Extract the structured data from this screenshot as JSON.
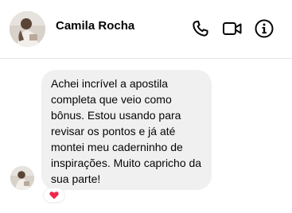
{
  "contact": {
    "name": "Camila Rocha",
    "avatar_icon": "profile-photo-icon"
  },
  "header_actions": [
    {
      "name": "call",
      "icon": "phone-icon"
    },
    {
      "name": "video",
      "icon": "video-camera-icon"
    },
    {
      "name": "info",
      "icon": "info-icon"
    }
  ],
  "message": {
    "text": "Achei incrível a apostila completa que veio como bônus. Estou usando para revisar os pontos e já até montei meu caderninho de inspirações. Muito capricho da sua parte!",
    "reaction": "heart-icon",
    "reaction_color": "#f02849"
  },
  "colors": {
    "bubble_bg": "#f0f0f0",
    "icon": "#050505",
    "divider": "#e4e6eb"
  }
}
